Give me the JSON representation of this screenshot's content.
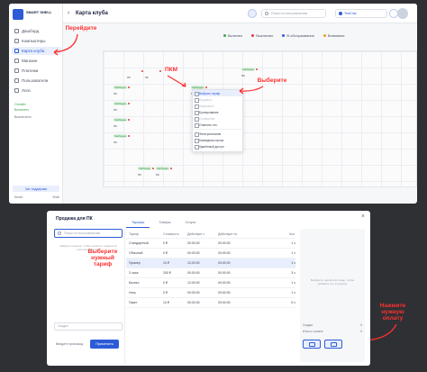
{
  "app": {
    "logo_text": "SMART SHELL",
    "page_title": "Карта клуба",
    "search_placeholder": "Поиск по пользователям",
    "club_name": "TestClub"
  },
  "sidebar": {
    "items": [
      {
        "label": "Дашборд"
      },
      {
        "label": "Компьютеры"
      },
      {
        "label": "Карта клуба"
      },
      {
        "label": "Магазин"
      },
      {
        "label": "Платежи"
      },
      {
        "label": "Пользователи"
      },
      {
        "label": "Логи"
      }
    ],
    "status_1": "Онлайн",
    "status_2": "Включено",
    "status_3": "Выключено",
    "help_label": "Чат поддержки",
    "bottom_left": "Smart",
    "bottom_right": "Shell"
  },
  "legend": {
    "on": "Включен",
    "off": "Выключен",
    "service": "В обслуживании",
    "attention": "Внимание",
    "colors": {
      "on": "#3fa34d",
      "off": "#e23b3b",
      "service": "#2d5bd8",
      "attention": "#e8a020"
    }
  },
  "map": {
    "pcs": [
      {
        "tag": "",
        "name": "ПК"
      },
      {
        "tag": "",
        "name": "ПК"
      },
      {
        "tag": "Свободен",
        "name": "ПК"
      },
      {
        "tag": "Свободен",
        "name": "ПК"
      },
      {
        "tag": "Свободен",
        "name": "ПК"
      },
      {
        "tag": "Свободен",
        "name": "ПК"
      },
      {
        "tag": "Свободен",
        "name": "ПК"
      },
      {
        "tag": "Свободен",
        "name": "ПК"
      },
      {
        "tag": "Свободен",
        "name": "ПК"
      },
      {
        "tag": "Свободен",
        "name": "ПК"
      }
    ]
  },
  "context_menu": {
    "items": [
      {
        "label": "Выбрать тариф",
        "state": "selected"
      },
      {
        "label": "Продлить",
        "state": "disabled"
      },
      {
        "label": "Завершить",
        "state": "disabled"
      },
      {
        "label": "Бронирование",
        "state": "normal"
      },
      {
        "label": "Сообщение",
        "state": "disabled"
      },
      {
        "label": "Отметить тех.",
        "state": "normal"
      },
      {
        "label": "Электропитание",
        "state": "normal"
      },
      {
        "label": "Командная строка",
        "state": "normal"
      },
      {
        "label": "Удалённый доступ",
        "state": "normal"
      },
      {
        "label": "Управление ПК",
        "state": "normal"
      }
    ]
  },
  "annotations": {
    "go": "Перейдите",
    "pkm": "ПКМ",
    "choose": "Выберите",
    "choose_tariff": "Выберите нужный тариф",
    "click_pay": "Нажмите нужную оплату"
  },
  "dialog": {
    "title": "Продажа для ПК",
    "close": "×",
    "search_placeholder": "Поиск по пользователям",
    "hint": "Найдите клиента, чтобы оплатить тариф или пополнить баланс",
    "select_placeholder": "Скидка",
    "apply_text": "Введите промокод",
    "apply_button": "Применить",
    "tabs": [
      {
        "label": "Тарифы"
      },
      {
        "label": "Товары"
      },
      {
        "label": "Услуги"
      }
    ],
    "table": {
      "headers": [
        "Тариф",
        "Стоимость",
        "Действует с",
        "Действует по",
        "Кол."
      ],
      "rows": [
        [
          "Стандартный",
          "0 ₽",
          "00:00:00",
          "00:00:00",
          "1 ч"
        ],
        [
          "Обычный",
          "0 ₽",
          "00:00:00",
          "00:00:00",
          "1 ч"
        ],
        [
          "Пример",
          "10 ₽",
          "12:00:00",
          "00:00:00",
          "1 ч"
        ],
        [
          "3 часа",
          "250 ₽",
          "00:00:00",
          "00:00:00",
          "3 ч"
        ],
        [
          "Бизнес",
          "0 ₽",
          "12:00:00",
          "00:00:00",
          "1 ч"
        ],
        [
          "Ночь",
          "0 ₽",
          "00:00:00",
          "00:00:00",
          "1 ч"
        ],
        [
          "Пакет",
          "10 ₽",
          "00:00:00",
          "00:00:00",
          "5 ч"
        ]
      ]
    },
    "empty_text": "Выберите тариф или товар, чтобы добавить его в корзину",
    "sum_label": "Скидка",
    "sum_value": "0",
    "total_label": "Итого к оплате",
    "total_value": "0"
  }
}
